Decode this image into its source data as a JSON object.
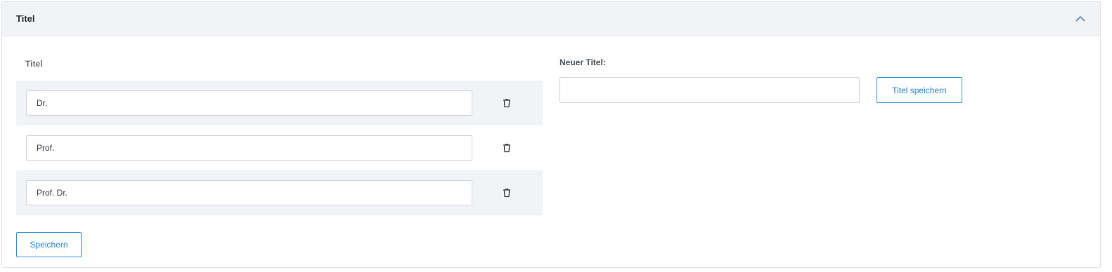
{
  "panel": {
    "title": "Titel",
    "collapse_icon": "chevron-up-icon"
  },
  "titles_list": {
    "column_label": "Titel",
    "rows": [
      {
        "value": "Dr.",
        "delete_icon": "trash-icon"
      },
      {
        "value": "Prof.",
        "delete_icon": "trash-icon"
      },
      {
        "value": "Prof. Dr.",
        "delete_icon": "trash-icon"
      }
    ],
    "save_label": "Speichern"
  },
  "new_title": {
    "label": "Neuer Titel:",
    "value": "",
    "placeholder": "",
    "save_label": "Titel speichern"
  },
  "colors": {
    "accent": "#2f86d1",
    "header_bg": "#f1f3f6",
    "row_shade": "#f1f3f6"
  }
}
